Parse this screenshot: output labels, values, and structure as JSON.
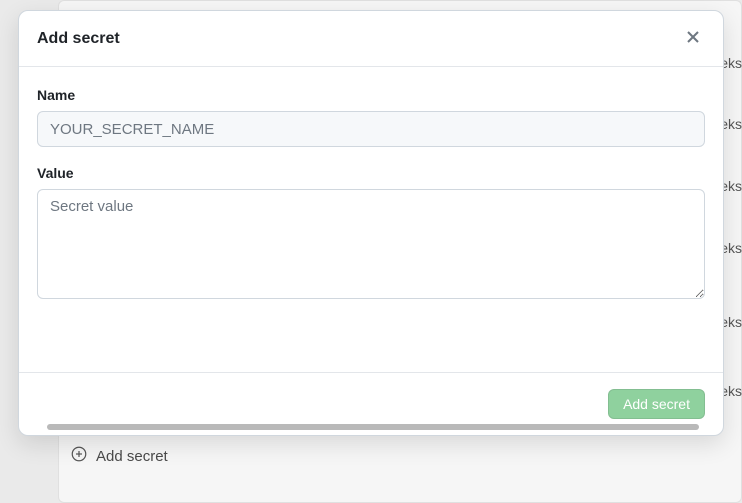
{
  "modal": {
    "title": "Add secret",
    "name_label": "Name",
    "name_placeholder": "YOUR_SECRET_NAME",
    "name_value": "",
    "value_label": "Value",
    "value_placeholder": "Secret value",
    "value_text": "",
    "submit_label": "Add secret"
  },
  "background": {
    "add_secret_label": "Add secret",
    "truncated_time_fragment": "eks"
  }
}
